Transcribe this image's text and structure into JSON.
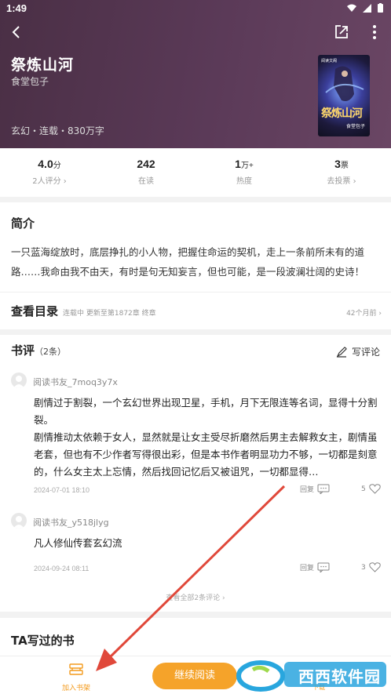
{
  "status_bar": {
    "time": "1:49"
  },
  "book": {
    "title": "祭炼山河",
    "author": "食堂包子",
    "meta": "玄幻・连载・830万字",
    "cover_title": "祭炼山河",
    "cover_author": "食堂包子",
    "cover_badge": "阅读文阁"
  },
  "stats": [
    {
      "value": "4.0",
      "unit": "分",
      "label": "2人评分 ›"
    },
    {
      "value": "242",
      "unit": "",
      "label": "在读"
    },
    {
      "value": "1",
      "unit": "万+",
      "label": "热度"
    },
    {
      "value": "3",
      "unit": "票",
      "label": "去投票 ›"
    }
  ],
  "intro": {
    "title": "简介",
    "text": "一只蓝海绽放时，底层挣扎的小人物，把握住命运的契机，走上一条前所未有的道路……我命由我不由天，有时是句无知妄言，但也可能，是一段波澜壮阔的史诗！"
  },
  "toc": {
    "title": "查看目录",
    "subtitle": "连载中 更新至第1872章 终章",
    "updated": "42个月前 ›"
  },
  "reviews": {
    "title": "书评",
    "count": "（2条）",
    "write_label": "写评论",
    "items": [
      {
        "name": "阅读书友_7moq3y7x",
        "text": "剧情过于割裂，一个玄幻世界出现卫星，手机，月下无限连等名词，显得十分割裂。\n剧情推动太依赖于女人，显然就是让女主受尽折磨然后男主去解救女主，剧情虽老套，但也有不少作者写得很出彩，但是本书作者明显功力不够，一切都是刻意的，什么女主太上忘情，然后找回记忆后又被诅咒，一切都显得…",
        "date": "2024-07-01 18:10",
        "reply": "回复",
        "likes": "5"
      },
      {
        "name": "阅读书友_y518jlyg",
        "text": "凡人修仙传套玄幻流",
        "date": "2024-09-24 08:11",
        "reply": "回复",
        "likes": "3"
      }
    ],
    "view_all": "查看全部2条评论 ›"
  },
  "other_books": {
    "title": "TA写过的书"
  },
  "bottom_bar": {
    "shelf_label": "加入书架",
    "read_label": "继续阅读",
    "download_label": "下载"
  },
  "watermark": {
    "text": "西西软件园"
  },
  "colors": {
    "accent": "#f5a32a",
    "header_bg": "#4f3350",
    "annotation_arrow": "#e0483a"
  },
  "icons": [
    "back-arrow-icon",
    "share-icon",
    "more-vertical-icon",
    "pen-icon",
    "comment-icon",
    "heart-icon",
    "bookshelf-icon"
  ]
}
